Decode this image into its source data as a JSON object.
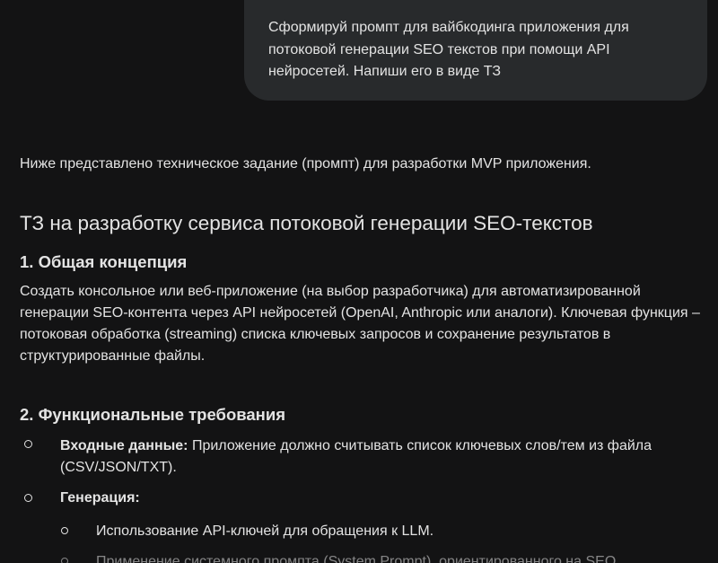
{
  "user_message": {
    "text": "Сформируй промпт для вайбкодинга приложения для потоковой генерации SEO текстов при помощи API нейросетей. Напиши его в виде ТЗ"
  },
  "response": {
    "intro": "Ниже представлено техническое задание (промпт) для разработки MVP приложения.",
    "title": "ТЗ на разработку сервиса потоковой генерации SEO-текстов",
    "section1": {
      "heading": "1. Общая концепция",
      "text": "Создать консольное или веб-приложение (на выбор разработчика) для автоматизированной генерации SEO-контента через API нейросетей (OpenAI, Anthropic или аналоги). Ключевая функция – потоковая обработка (streaming) списка ключевых запросов и сохранение результатов в структурированные файлы."
    },
    "section2": {
      "heading": "2. Функциональные требования",
      "items": [
        {
          "label": "Входные данные:",
          "text": " Приложение должно считывать список ключевых слов/тем из файла (CSV/JSON/TXT)."
        },
        {
          "label": "Генерация:",
          "text": ""
        }
      ],
      "subitems": [
        {
          "text": "Использование API-ключей для обращения к LLM."
        },
        {
          "text": "Применение системного промпта (System Prompt), ориентированного на SEO"
        }
      ]
    }
  }
}
